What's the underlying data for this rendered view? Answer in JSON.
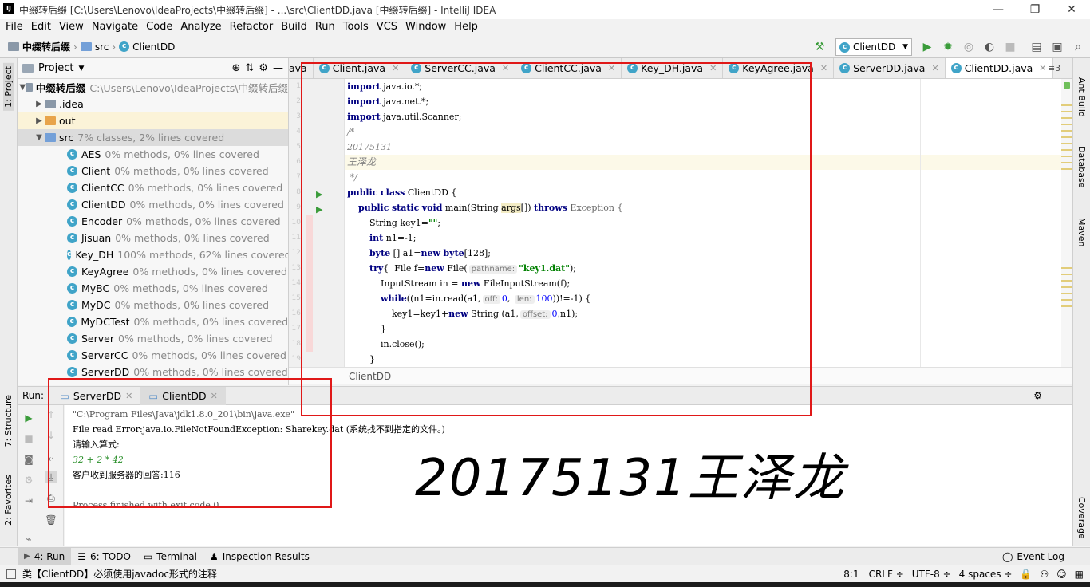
{
  "window": {
    "title": "中缀转后缀 [C:\\Users\\Lenovo\\IdeaProjects\\中缀转后缀] - ...\\src\\ClientDD.java [中缀转后缀] - IntelliJ IDEA",
    "logo": "IJ"
  },
  "menu": [
    "File",
    "Edit",
    "View",
    "Navigate",
    "Code",
    "Analyze",
    "Refactor",
    "Build",
    "Run",
    "Tools",
    "VCS",
    "Window",
    "Help"
  ],
  "nav": {
    "project": "中缀转后缀",
    "folder": "src",
    "file": "ClientDD",
    "run_config": "ClientDD"
  },
  "left_strip": {
    "project": "1: Project",
    "structure": "7: Structure",
    "favorites": "2: Favorites"
  },
  "right_strip": {
    "ant": "Ant Build",
    "database": "Database",
    "maven": "Maven",
    "coverage": "Coverage"
  },
  "project_panel": {
    "title": "Project",
    "root_name": "中缀转后缀",
    "root_path": "C:\\Users\\Lenovo\\IdeaProjects\\中缀转后缀",
    "folders": [
      {
        "name": ".idea"
      },
      {
        "name": "out"
      }
    ],
    "src": {
      "name": "src",
      "coverage": "7% classes, 2% lines covered"
    },
    "classes": [
      {
        "name": "AES",
        "coverage": "0% methods, 0% lines covered"
      },
      {
        "name": "Client",
        "coverage": "0% methods, 0% lines covered"
      },
      {
        "name": "ClientCC",
        "coverage": "0% methods, 0% lines covered"
      },
      {
        "name": "ClientDD",
        "coverage": "0% methods, 0% lines covered"
      },
      {
        "name": "Encoder",
        "coverage": "0% methods, 0% lines covered"
      },
      {
        "name": "Jisuan",
        "coverage": "0% methods, 0% lines covered"
      },
      {
        "name": "Key_DH",
        "coverage": "100% methods, 62% lines covered"
      },
      {
        "name": "KeyAgree",
        "coverage": "0% methods, 0% lines covered"
      },
      {
        "name": "MyBC",
        "coverage": "0% methods, 0% lines covered"
      },
      {
        "name": "MyDC",
        "coverage": "0% methods, 0% lines covered"
      },
      {
        "name": "MyDCTest",
        "coverage": "0% methods, 0% lines covered"
      },
      {
        "name": "Server",
        "coverage": "0% methods, 0% lines covered"
      },
      {
        "name": "ServerCC",
        "coverage": "0% methods, 0% lines covered"
      },
      {
        "name": "ServerDD",
        "coverage": "0% methods, 0% lines covered"
      }
    ]
  },
  "editor_tabs": [
    {
      "label": "ava"
    },
    {
      "label": "Client.java"
    },
    {
      "label": "ServerCC.java"
    },
    {
      "label": "ClientCC.java"
    },
    {
      "label": "Key_DH.java"
    },
    {
      "label": "KeyAgree.java"
    },
    {
      "label": "ServerDD.java"
    },
    {
      "label": "ClientDD.java"
    }
  ],
  "editor_tabs_more": "≡3",
  "code_lines": [
    "import java.io.*;",
    "import java.net.*;",
    "import java.util.Scanner;",
    "/*",
    "20175131",
    "王泽龙",
    " */",
    "public class ClientDD {",
    "    public static void main(String args[]) throws Exception {",
    "        String key1=\"\";",
    "        int n1=-1;",
    "        byte [] a1=new byte[128];",
    "        try{  File f=new File( pathname: \"key1.dat\");",
    "            InputStream in = new FileInputStream(f);",
    "            while((n1=in.read(a1,  off: 0,  len: 100))!=-1) {",
    "                key1=key1+new String (a1,  offset: 0,n1);",
    "            }",
    "            in.close();",
    "        }"
  ],
  "code": {
    "kw_import": "import",
    "pkg_io": "java.io.*;",
    "pkg_net": "java.net.*;",
    "pkg_util": "java.util.Scanner;",
    "c_open": "/*",
    "c_id": "20175131",
    "c_name": "王泽龙",
    "c_close": " */",
    "kw_public": "public",
    "kw_class": "class",
    "class_name": "ClientDD {",
    "kw_static": "static",
    "kw_void": "void",
    "main_sig": "main(String ",
    "main_args": "args",
    "main_br": "[]) ",
    "kw_throws": "throws",
    "exc": " Exception {",
    "l10a": "String key1=",
    "l10s": "\"\"",
    "l10b": ";",
    "kw_int": "int",
    "l11": " n1=-1;",
    "kw_byte": "byte",
    "l12a": " [] a1=",
    "kw_new": "new",
    "l12b": "[128];",
    "kw_try": "try",
    "l13a": "{  File f=",
    "l13b": " File(",
    "hint_pathname": "pathname:",
    "l13s": "\"key1.dat\"",
    "l13c": ");",
    "l14a": "InputStream in = ",
    "l14b": " FileInputStream(f);",
    "kw_while": "while",
    "l15a": "((n1=in.read(a1,",
    "hint_off": "off:",
    "n0": "0",
    "hint_len": "len:",
    "n100": "100",
    "l15b": "))!=-1) {",
    "l16a": "key1=key1+",
    "l16b": " String (a1,",
    "hint_offset": "offset:",
    "l16c": ",n1);",
    "brace": "}",
    "l18": "in.close();"
  },
  "breadcrumb": "ClientDD",
  "run_panel": {
    "label": "Run:",
    "tabs": [
      {
        "label": "ServerDD"
      },
      {
        "label": "ClientDD"
      }
    ],
    "console": [
      "\"C:\\Program Files\\Java\\jdk1.8.0_201\\bin\\java.exe\"",
      "File read Error:java.io.FileNotFoundException: Sharekey.dat (系统找不到指定的文件。)",
      "请输入算式:",
      "32 + 2 * 42",
      "客户收到服务器的回答:116",
      "",
      "Process finished with exit code 0"
    ]
  },
  "watermark": "20175131王泽龙",
  "bottom_tabs": [
    {
      "label": "4: Run"
    },
    {
      "label": "6: TODO"
    },
    {
      "label": "Terminal"
    },
    {
      "label": "Inspection Results"
    }
  ],
  "event_log": "Event Log",
  "status": {
    "message": "类【ClientDD】必须使用javadoc形式的注释",
    "position": "8:1",
    "line_sep": "CRLF ÷",
    "encoding": "UTF-8 ÷",
    "indent": "4 spaces ÷"
  },
  "colors": {
    "red_box": "#e01818",
    "keyword": "#000080",
    "string": "#008000",
    "comment": "#808080"
  }
}
